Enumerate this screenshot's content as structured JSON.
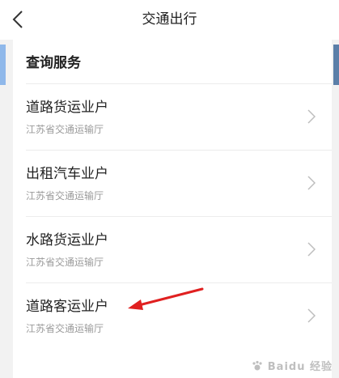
{
  "navbar": {
    "title": "交通出行"
  },
  "section": {
    "title": "查询服务"
  },
  "items": [
    {
      "name": "道路货运业户",
      "sub": "江苏省交通运输厅"
    },
    {
      "name": "出租汽车业户",
      "sub": "江苏省交通运输厅"
    },
    {
      "name": "水路货运业户",
      "sub": "江苏省交通运输厅"
    },
    {
      "name": "道路客运业户",
      "sub": "江苏省交通运输厅"
    }
  ],
  "watermark": {
    "text": "Baidu 经验"
  },
  "colors": {
    "annotation_arrow": "#e02020"
  }
}
